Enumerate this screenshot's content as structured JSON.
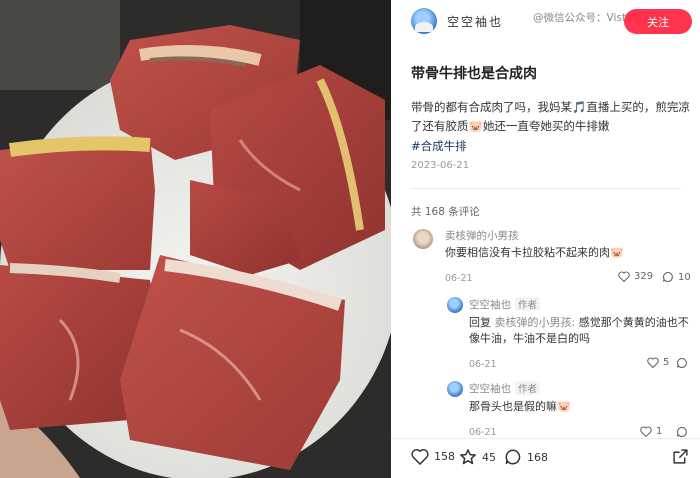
{
  "header": {
    "author": "空空袖也",
    "follow_label": "关注",
    "watermark": "@微信公众号：Vista看商业"
  },
  "post": {
    "title": "带骨牛排也是合成肉",
    "body": "带骨的都有合成肉了吗，我妈某🎵直播上买的，煎完凉了还有胶质🐷她还一直夸她买的牛排嫩",
    "hashtag": "#合成牛排",
    "date": "2023-06-21"
  },
  "comments_header": "共 168 条评论",
  "comments": [
    {
      "name": "卖核弹的小男孩",
      "text": "你要相信没有卡拉胶粘不起来的肉🐷",
      "date": "06-21",
      "likes": "329",
      "replies": "10"
    }
  ],
  "replies": [
    {
      "name": "空空袖也",
      "tag": "作者",
      "prefix": "回复",
      "reply_to": "卖核弹的小男孩:",
      "text": "感觉那个黄黄的油也不像牛油，牛油不是白的吗",
      "date": "06-21",
      "likes": "5"
    },
    {
      "name": "空空袖也",
      "tag": "作者",
      "text": "那骨头也是假的嘛🐷",
      "date": "06-21",
      "likes": "1"
    }
  ],
  "bottom_bar": {
    "likes": "158",
    "stars": "45",
    "comments": "168"
  },
  "colors": {
    "accent": "#ff2442",
    "hashtag": "#13386c",
    "meat": "#b2473f"
  },
  "icons": [
    "heart-icon",
    "star-icon",
    "comment-icon",
    "share-icon"
  ]
}
